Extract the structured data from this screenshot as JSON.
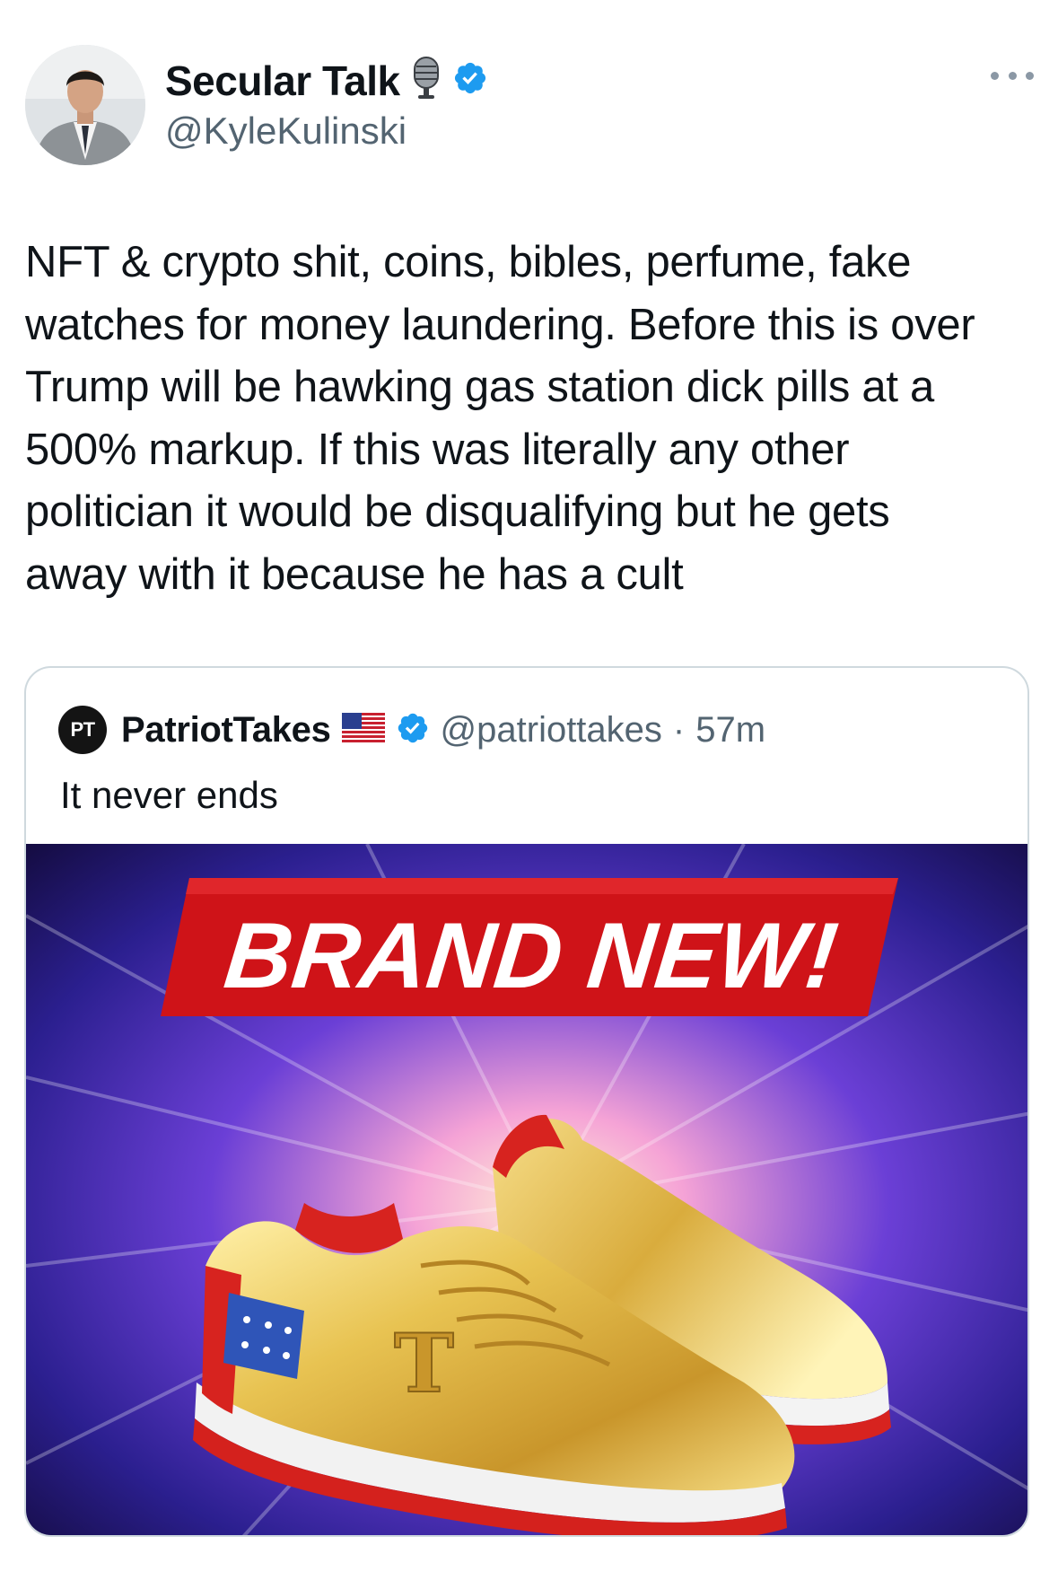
{
  "author": {
    "display_name": "Secular Talk",
    "handle": "@KyleKulinski",
    "name_emoji_icon": "microphone-icon",
    "verified_icon": "verified-badge-icon"
  },
  "post": {
    "text": "NFT & crypto shit, coins, bibles, perfume, fake\nwatches for money laundering. Before this is over\nTrump will be hawking gas station dick pills at a\n500% markup. If this was literally any other\npolitician it would be disqualifying but he gets\naway with it because he has a cult"
  },
  "quoted_post": {
    "avatar_text": "PT",
    "display_name": "PatriotTakes",
    "flag_icon": "us-flag-icon",
    "handle": "@patriottakes",
    "separator": "·",
    "time": "57m",
    "text": "It never ends",
    "image": {
      "banner_text": "BRAND NEW!",
      "shoe_letter": "T"
    }
  },
  "colors": {
    "verified_blue": "#1d9bf0",
    "banner_red": "#d1141b",
    "gold": "#e3b845"
  }
}
